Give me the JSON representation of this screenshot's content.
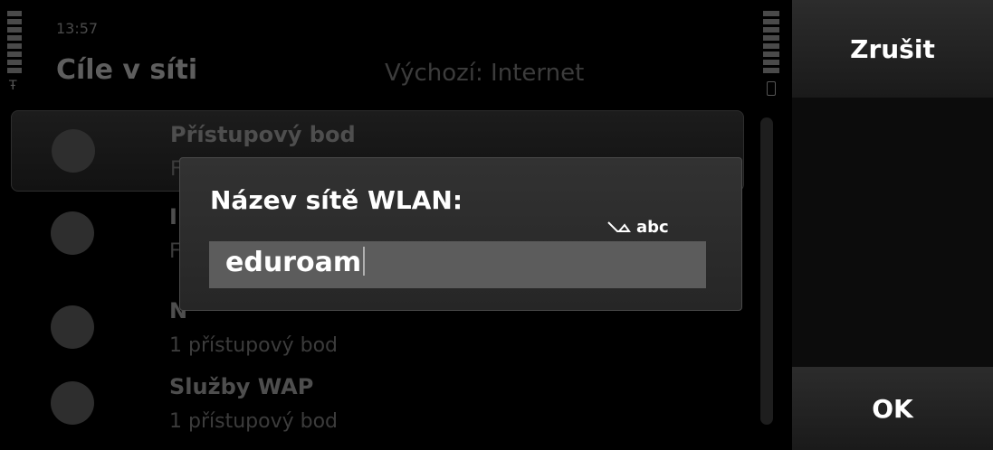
{
  "status": {
    "time": "13:57"
  },
  "header": {
    "title": "Cíle v síti",
    "default_destination": "Výchozí: Internet"
  },
  "list": {
    "items": [
      {
        "name": "Přístupový bod",
        "sub": "F",
        "icon": "globe-compass-icon"
      },
      {
        "name": "I",
        "sub": "F",
        "icon": "globe-icon"
      },
      {
        "name": "N",
        "sub": "1 přístupový bod",
        "icon": "mms-icon"
      },
      {
        "name": "Služby WAP",
        "sub": "1 přístupový bod",
        "icon": "opera-icon"
      }
    ]
  },
  "dialog": {
    "title": "Název sítě WLAN:",
    "input_mode": "abc",
    "input_value": "eduroam"
  },
  "softkeys": {
    "top": "Zrušit",
    "bottom": "OK"
  }
}
